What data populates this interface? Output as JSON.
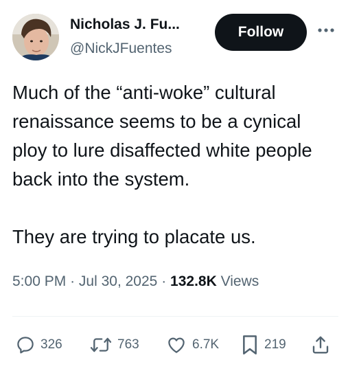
{
  "author": {
    "display_name": "Nicholas J. Fu...",
    "handle": "@NickJFuentes"
  },
  "header": {
    "follow_label": "Follow",
    "more_icon": "more-horizontal-icon"
  },
  "tweet": {
    "text": "Much of the “anti-woke” cultural renaissance seems to be a cynical ploy to lure disaffected white people back into the system.\n\nThey are trying to placate us.",
    "time": "5:00 PM",
    "date": "Jul 30, 2025",
    "separator": "·",
    "views_count": "132.8K",
    "views_label": "Views"
  },
  "actions": {
    "replies": "326",
    "reposts": "763",
    "likes": "6.7K",
    "bookmarks": "219",
    "reply_icon": "reply-icon",
    "repost_icon": "repost-icon",
    "like_icon": "heart-icon",
    "bookmark_icon": "bookmark-icon",
    "share_icon": "share-icon"
  },
  "colors": {
    "text": "#0f1419",
    "secondary": "#536471",
    "button_bg": "#0f1419",
    "button_text": "#ffffff",
    "divider": "#eff3f4"
  }
}
